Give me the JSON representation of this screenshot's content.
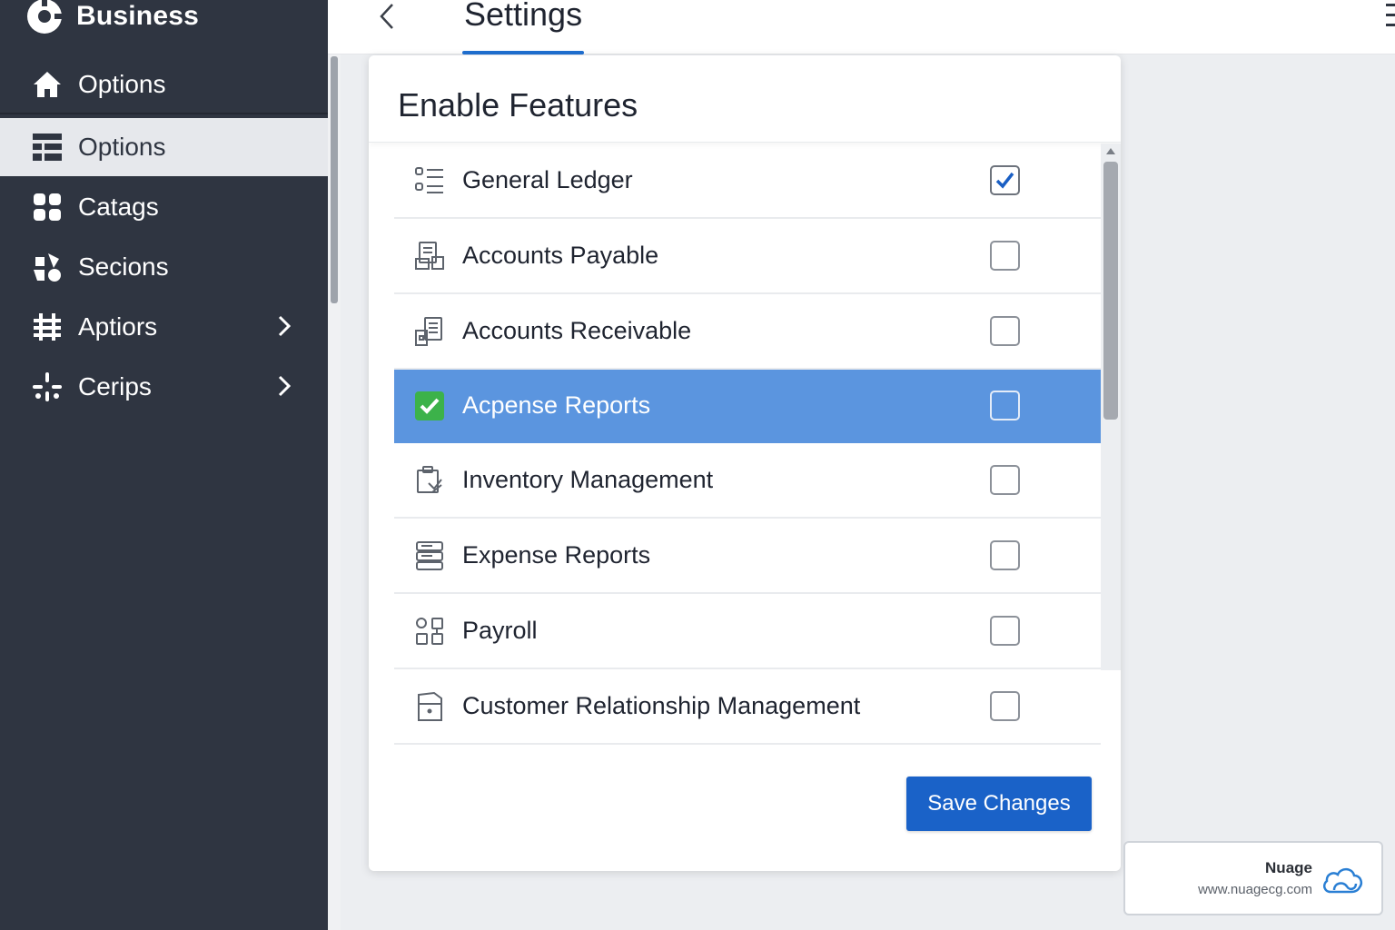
{
  "sidebar": {
    "brand": "Business",
    "items": [
      {
        "label": "Options",
        "icon": "home-icon",
        "has_chevron": false
      },
      {
        "label": "Options",
        "icon": "table-icon",
        "has_chevron": false,
        "active": true
      },
      {
        "label": "Catags",
        "icon": "grid-icon",
        "has_chevron": false
      },
      {
        "label": "Secions",
        "icon": "sections-icon",
        "has_chevron": false
      },
      {
        "label": "Aptiors",
        "icon": "hash-icon",
        "has_chevron": true
      },
      {
        "label": "Cerips",
        "icon": "sparkle-icon",
        "has_chevron": true
      }
    ]
  },
  "header": {
    "tab_label": "Settings"
  },
  "panel": {
    "title": "Enable Features",
    "features": [
      {
        "label": "General Ledger",
        "icon": "list-icon",
        "checked": true
      },
      {
        "label": "Accounts Payable",
        "icon": "payable-icon",
        "checked": false
      },
      {
        "label": "Accounts Receivable",
        "icon": "receivable-icon",
        "checked": false
      },
      {
        "label": "Acpense Reports",
        "icon": "green-check-icon",
        "checked": false,
        "selected": true
      },
      {
        "label": "Inventory Management",
        "icon": "inventory-icon",
        "checked": false
      },
      {
        "label": "Expense Reports",
        "icon": "server-icon",
        "checked": false
      },
      {
        "label": "Payroll",
        "icon": "shapes-icon",
        "checked": false
      },
      {
        "label": "Customer Relationship Management",
        "icon": "door-icon",
        "checked": false
      }
    ],
    "save_label": "Save Changes"
  },
  "watermark": {
    "name": "Nuage",
    "url": "www.nuagecg.com",
    "logo_icon": "cloud-icon"
  },
  "colors": {
    "sidebar_bg": "#2f3541",
    "accent": "#1a62c8",
    "selected_row": "#5b95df",
    "check_green": "#3cb24a"
  }
}
